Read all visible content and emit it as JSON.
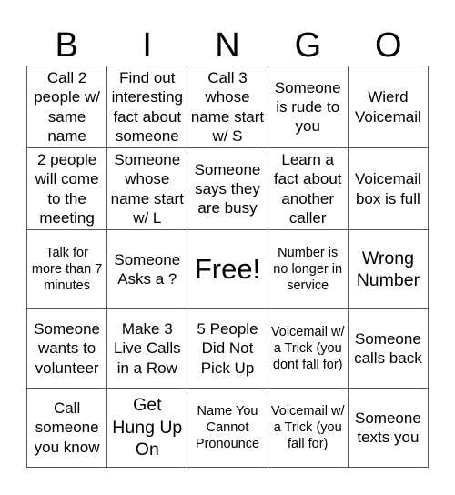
{
  "header": {
    "letters": [
      "B",
      "I",
      "N",
      "G",
      "O"
    ]
  },
  "cells": [
    {
      "text": "Call 2 people w/ same name",
      "size": "m"
    },
    {
      "text": "Find out interesting fact about someone",
      "size": "m"
    },
    {
      "text": "Call 3 whose name start w/ S",
      "size": "m"
    },
    {
      "text": "Someone is rude to you",
      "size": "m"
    },
    {
      "text": "Wierd Voicemail",
      "size": "m"
    },
    {
      "text": "2 people will come to the meeting",
      "size": "m"
    },
    {
      "text": "Someone whose name start w/ L",
      "size": "m"
    },
    {
      "text": "Someone says they are busy",
      "size": "m"
    },
    {
      "text": "Learn a fact about another caller",
      "size": "m"
    },
    {
      "text": "Voicemail box is full",
      "size": "m"
    },
    {
      "text": "Talk for more than 7 minutes",
      "size": "s"
    },
    {
      "text": "Someone Asks a ?",
      "size": "m"
    },
    {
      "text": "Free!",
      "size": "xl"
    },
    {
      "text": "Number is no longer in service",
      "size": "s"
    },
    {
      "text": "Wrong Number",
      "size": "l"
    },
    {
      "text": "Someone wants to volunteer",
      "size": "m"
    },
    {
      "text": "Make 3 Live Calls in a Row",
      "size": "m"
    },
    {
      "text": "5 People Did Not Pick Up",
      "size": "m"
    },
    {
      "text": "Voicemail w/ a Trick (you dont fall for)",
      "size": "s"
    },
    {
      "text": "Someone calls back",
      "size": "m"
    },
    {
      "text": "Call someone you know",
      "size": "m"
    },
    {
      "text": "Get Hung Up On",
      "size": "l"
    },
    {
      "text": "Name You Cannot Pronounce",
      "size": "s"
    },
    {
      "text": "Voicemail w/ a Trick (you fall for)",
      "size": "s"
    },
    {
      "text": "Someone texts you",
      "size": "m"
    }
  ]
}
